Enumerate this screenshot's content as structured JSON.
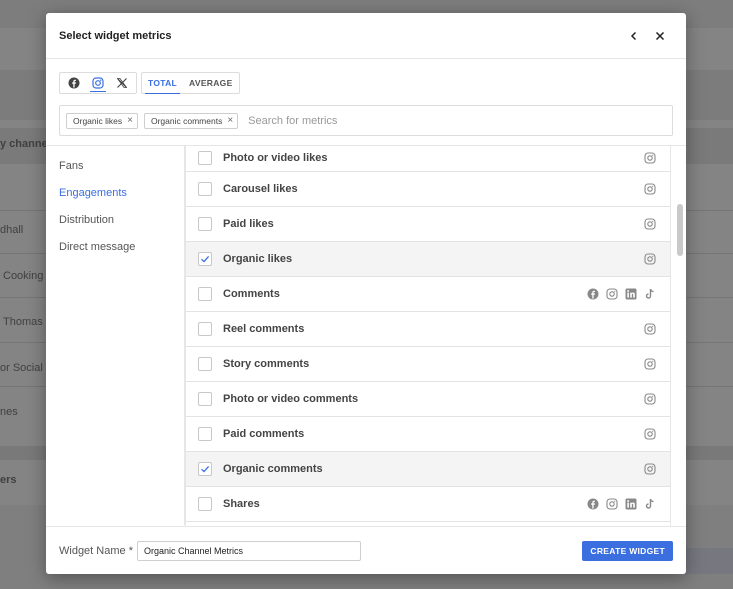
{
  "modal": {
    "title": "Select widget metrics",
    "networks": [
      "facebook-icon",
      "instagram-icon",
      "x-icon"
    ],
    "active_network": "instagram-icon",
    "aggregation": {
      "total": "TOTAL",
      "average": "AVERAGE",
      "active": "TOTAL"
    },
    "selected_chips": [
      {
        "label": "Organic likes"
      },
      {
        "label": "Organic comments"
      }
    ],
    "search": {
      "placeholder": "Search for metrics",
      "value": ""
    },
    "categories": [
      {
        "label": "Fans",
        "active": false
      },
      {
        "label": "Engagements",
        "active": true
      },
      {
        "label": "Distribution",
        "active": false
      },
      {
        "label": "Direct message",
        "active": false
      }
    ],
    "metrics": [
      {
        "label": "Photo or video likes",
        "checked": false,
        "icons": [
          "instagram-icon"
        ]
      },
      {
        "label": "Carousel likes",
        "checked": false,
        "icons": [
          "instagram-icon"
        ]
      },
      {
        "label": "Paid likes",
        "checked": false,
        "icons": [
          "instagram-icon"
        ]
      },
      {
        "label": "Organic likes",
        "checked": true,
        "icons": [
          "instagram-icon"
        ]
      },
      {
        "label": "Comments",
        "checked": false,
        "icons": [
          "facebook-icon",
          "instagram-icon",
          "linkedin-icon",
          "tiktok-icon"
        ]
      },
      {
        "label": "Reel comments",
        "checked": false,
        "icons": [
          "instagram-icon"
        ]
      },
      {
        "label": "Story comments",
        "checked": false,
        "icons": [
          "instagram-icon"
        ]
      },
      {
        "label": "Photo or video comments",
        "checked": false,
        "icons": [
          "instagram-icon"
        ]
      },
      {
        "label": "Paid comments",
        "checked": false,
        "icons": [
          "instagram-icon"
        ]
      },
      {
        "label": "Organic comments",
        "checked": true,
        "icons": [
          "instagram-icon"
        ]
      },
      {
        "label": "Shares",
        "checked": false,
        "icons": [
          "facebook-icon",
          "instagram-icon",
          "linkedin-icon",
          "tiktok-icon"
        ]
      }
    ],
    "footer": {
      "name_label": "Widget Name *",
      "name_value": "Organic Channel Metrics",
      "create_label": "CREATE WIDGET"
    }
  },
  "background": {
    "items": [
      "y channel",
      "dhall",
      "Cooking",
      "Thomas",
      "or Social",
      "nes",
      "ers"
    ]
  },
  "colors": {
    "accent": "#3b6fe0",
    "overlay": "rgba(40,40,40,0.45)"
  }
}
